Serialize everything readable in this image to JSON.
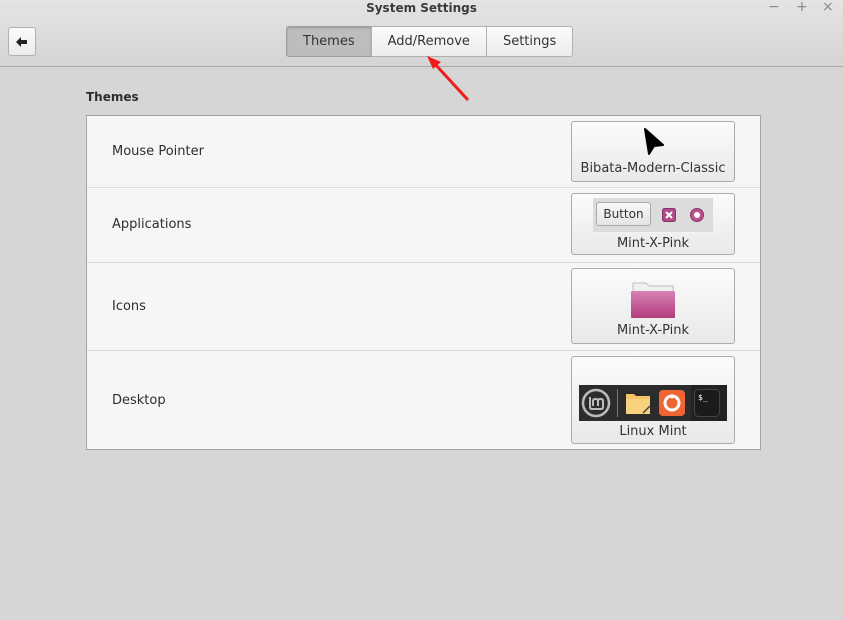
{
  "window": {
    "title": "System Settings",
    "controls": {
      "minimize": "−",
      "maximize": "+",
      "close": "×"
    }
  },
  "toolbar": {
    "back_icon": "back-arrow-icon",
    "tabs": [
      {
        "label": "Themes",
        "active": true
      },
      {
        "label": "Add/Remove",
        "active": false
      },
      {
        "label": "Settings",
        "active": false
      }
    ]
  },
  "main": {
    "section_title": "Themes",
    "rows": [
      {
        "label": "Mouse Pointer",
        "value": "Bibata-Modern-Classic",
        "preview": "cursor-arrow-icon"
      },
      {
        "label": "Applications",
        "value": "Mint-X-Pink",
        "preview_button": "Button",
        "preview": "widget-preview"
      },
      {
        "label": "Icons",
        "value": "Mint-X-Pink",
        "preview": "folder-icon"
      },
      {
        "label": "Desktop",
        "value": "Linux Mint",
        "preview": "panel-preview"
      }
    ]
  },
  "colors": {
    "accent_pink": "#c0508f",
    "annotation_arrow": "#ee1c1c"
  }
}
